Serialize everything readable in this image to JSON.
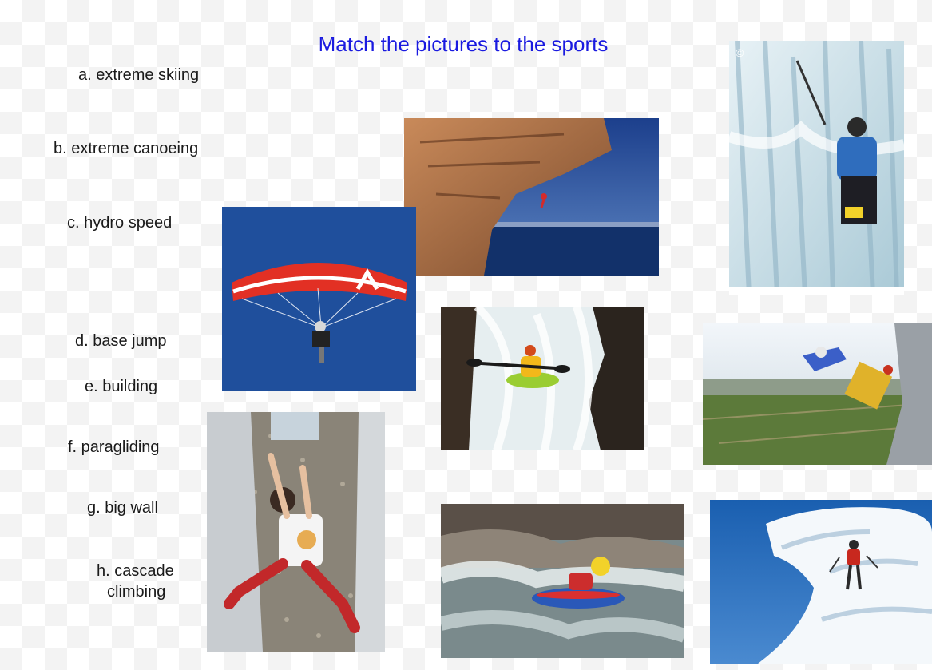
{
  "title": "Match the pictures to the sports",
  "items": [
    {
      "text": "a. extreme skiing"
    },
    {
      "text": "b. extreme canoeing"
    },
    {
      "text": "c. hydro speed"
    },
    {
      "text": "d. base jump"
    },
    {
      "text": "e. building"
    },
    {
      "text": "f. paragliding"
    },
    {
      "text": "g. big wall"
    },
    {
      "text": "h. cascade"
    },
    {
      "text": "climbing"
    }
  ],
  "photos": [
    {
      "name": "big-wall-climbing-photo"
    },
    {
      "name": "ice-cascade-climbing-photo"
    },
    {
      "name": "paragliding-photo"
    },
    {
      "name": "waterfall-kayak-photo"
    },
    {
      "name": "base-jump-photo"
    },
    {
      "name": "building-climbing-photo"
    },
    {
      "name": "hydro-speed-photo"
    },
    {
      "name": "extreme-skiing-photo"
    }
  ]
}
